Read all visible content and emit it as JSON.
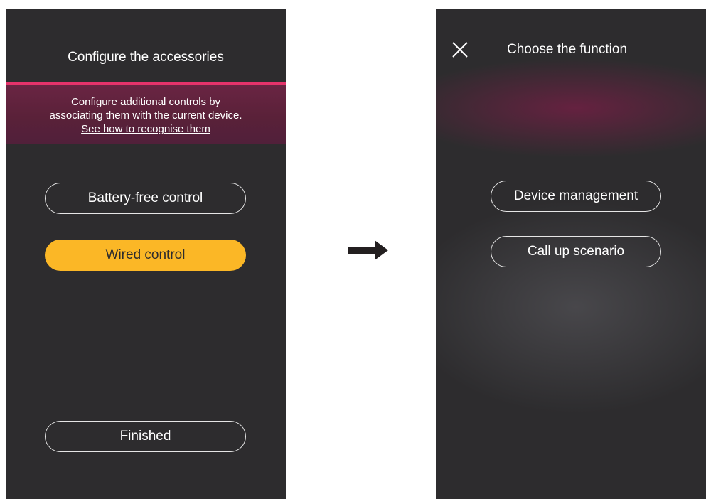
{
  "left_screen": {
    "title": "Configure the accessories",
    "info": {
      "line1": "Configure additional controls by",
      "line2": "associating them with the current device.",
      "link": "See how to recognise them"
    },
    "buttons": {
      "battery_free": "Battery-free control",
      "wired": "Wired control",
      "finished": "Finished"
    },
    "selected": "Wired control"
  },
  "right_screen": {
    "close_icon": "close-icon",
    "title": "Choose the function",
    "buttons": {
      "device_management": "Device management",
      "call_up_scenario": "Call up scenario"
    }
  },
  "colors": {
    "screen_bg": "#2d2c2e",
    "accent_yellow": "#fbb726",
    "accent_magenta": "#e5336b",
    "band_bg": "#5a2139"
  },
  "arrow_icon": "right-arrow-icon"
}
